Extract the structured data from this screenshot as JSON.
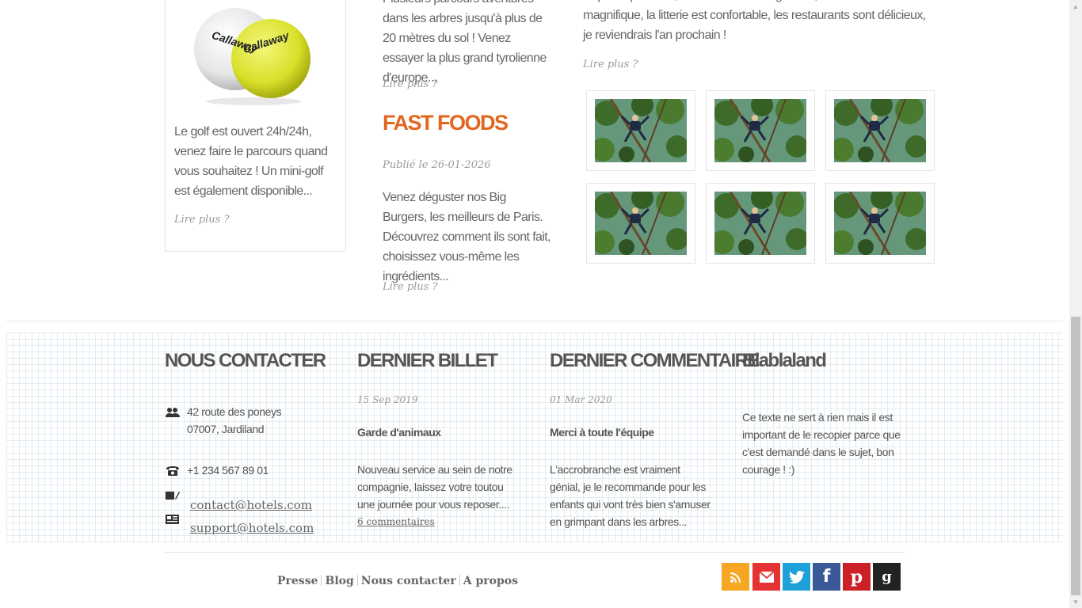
{
  "golf": {
    "ball_brand": "Callaway",
    "text": "Le golf est ouvert 24h/24h, venez faire le parcours quand vous souhaitez ! Un mini-golf est également disponible...",
    "more": "Lire plus ?"
  },
  "article_trees": {
    "text": "Plusieurs parcours aventures dans les arbres jusqu'à plus de 20 mètres du sol ! Venez essayer la plus grand tyrolienne d'europe...",
    "more": "Lire plus ?"
  },
  "article_fastfoods": {
    "title": "FAST FOODS",
    "date": "Publié le 26-01-2026",
    "text": "Venez déguster nos Big Burgers, les meilleurs de Paris. Découvrez comment ils sont fait, choisissez vous-même les ingrédients...",
    "more": "Lire plus ?"
  },
  "review": {
    "text": "Super expérience, le sauna est très agréable, le cadre est magnifique, la litterie est confortable, les restaurants sont délicieux, je reviendrais l'an prochain !",
    "more": "Lire plus ?"
  },
  "footer": {
    "contact": {
      "heading": "NOUS CONTACTER",
      "address_line1": "42 route des poneys",
      "address_line2": "07007, Jardiland",
      "phone": "+1 234 567 89 01",
      "email1": "contact@hotels.com",
      "email2": "support@hotels.com"
    },
    "last_post": {
      "heading": "DERNIER BILLET",
      "date": "15 Sep 2019",
      "title": "Garde d'animaux",
      "text": "Nouveau service au sein de notre compagnie, laissez votre toutou une journée pour vous reposer....",
      "comments": "6 commentaires"
    },
    "last_comment": {
      "heading": "DERNIER COMMENTAIRE",
      "date": "01 Mar 2020",
      "title": "Merci à toute l'équipe",
      "text": "L'accrobranche est vraiment génial, je le recommande pour les enfants qui vont très bien s'amuser en grimpant dans les arbres..."
    },
    "about": {
      "heading": "Blablaland",
      "text": "Ce texte ne sert à rien mais il est important de le recopier parce que c'est demandé dans le sujet, bon courage ! :)"
    },
    "nav": [
      "Presse",
      "Blog",
      "Nous contacter",
      "A propos"
    ],
    "social": [
      {
        "name": "rss",
        "color": "#f6a623"
      },
      {
        "name": "email",
        "color": "#e53232"
      },
      {
        "name": "twitter",
        "color": "#1da1d8"
      },
      {
        "name": "facebook",
        "color": "#3b5998"
      },
      {
        "name": "pinterest",
        "color": "#cb2027"
      },
      {
        "name": "google",
        "color": "#222222"
      }
    ]
  }
}
